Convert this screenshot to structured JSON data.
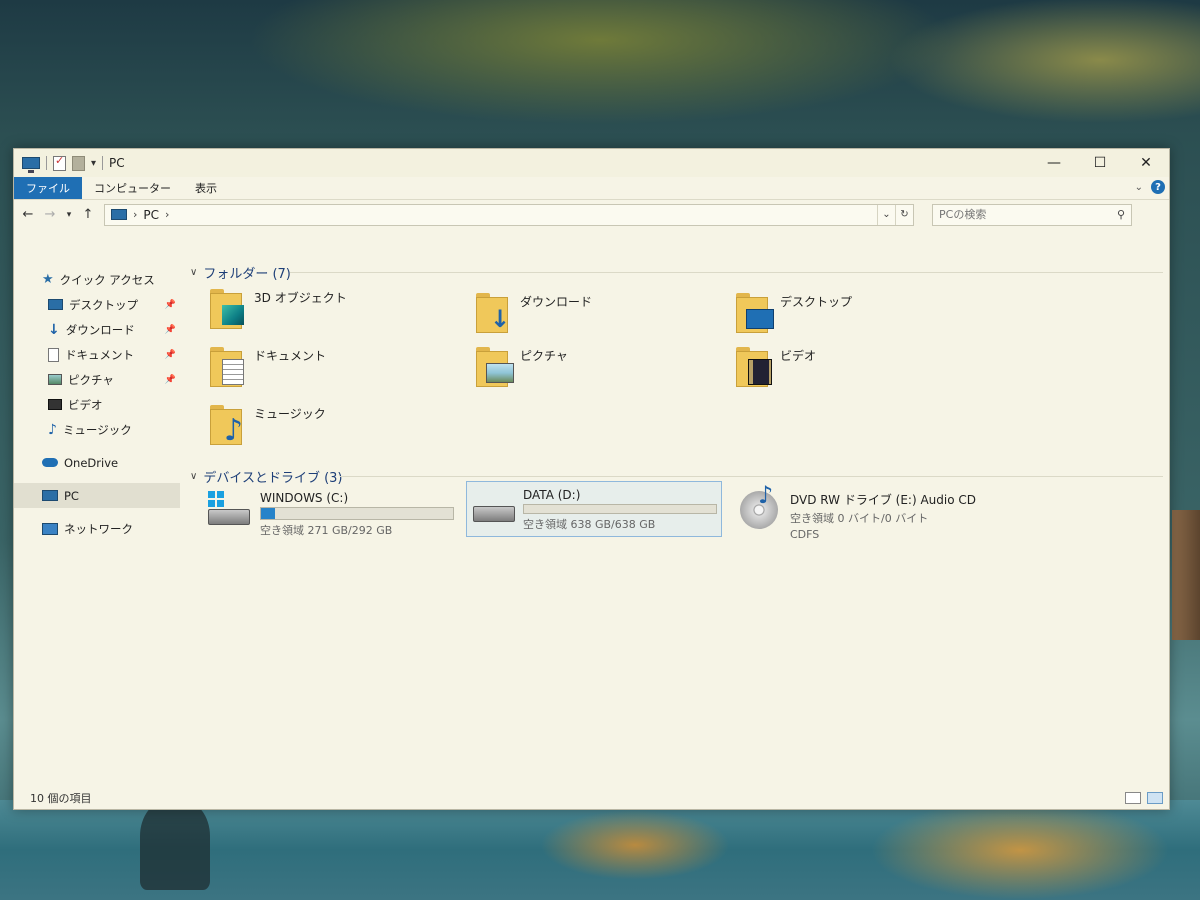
{
  "window": {
    "title": "PC",
    "controls": {
      "minimize": "—",
      "maximize": "☐",
      "close": "✕"
    }
  },
  "ribbon": {
    "tabs": [
      {
        "label": "ファイル"
      },
      {
        "label": "コンピューター"
      },
      {
        "label": "表示"
      }
    ]
  },
  "address": {
    "crumbs": [
      "PC"
    ],
    "search_placeholder": "PCの検索"
  },
  "sidebar": {
    "quick_access": "クイック アクセス",
    "pinned": [
      {
        "label": "デスクトップ",
        "icon": "desktop-icon"
      },
      {
        "label": "ダウンロード",
        "icon": "download-icon"
      },
      {
        "label": "ドキュメント",
        "icon": "document-icon"
      },
      {
        "label": "ピクチャ",
        "icon": "pictures-icon"
      },
      {
        "label": "ビデオ",
        "icon": "video-icon"
      },
      {
        "label": "ミュージック",
        "icon": "music-icon"
      }
    ],
    "onedrive": "OneDrive",
    "pc": "PC",
    "network": "ネットワーク"
  },
  "folders": {
    "header": "フォルダー (7)",
    "items": [
      {
        "label": "3D オブジェクト",
        "icon": "3d-objects-icon"
      },
      {
        "label": "ダウンロード",
        "icon": "downloads-folder-icon"
      },
      {
        "label": "デスクトップ",
        "icon": "desktop-folder-icon"
      },
      {
        "label": "ドキュメント",
        "icon": "documents-folder-icon"
      },
      {
        "label": "ピクチャ",
        "icon": "pictures-folder-icon"
      },
      {
        "label": "ビデオ",
        "icon": "videos-folder-icon"
      },
      {
        "label": "ミュージック",
        "icon": "music-folder-icon"
      }
    ]
  },
  "drives": {
    "header": "デバイスとドライブ (3)",
    "items": [
      {
        "name": "WINDOWS (C:)",
        "free": "空き領域 271 GB/292 GB",
        "used_fraction": 0.072
      },
      {
        "name": "DATA (D:)",
        "free": "空き領域 638 GB/638 GB",
        "used_fraction": 0.0
      },
      {
        "name": "DVD RW ドライブ (E:) Audio CD",
        "free": "空き領域 0 バイト/0 バイト",
        "fs": "CDFS"
      }
    ]
  },
  "status": {
    "count": "10 個の項目"
  },
  "colors": {
    "accent": "#1f6fb4",
    "progress": "#2683c9",
    "group_header": "#1e3f78"
  }
}
